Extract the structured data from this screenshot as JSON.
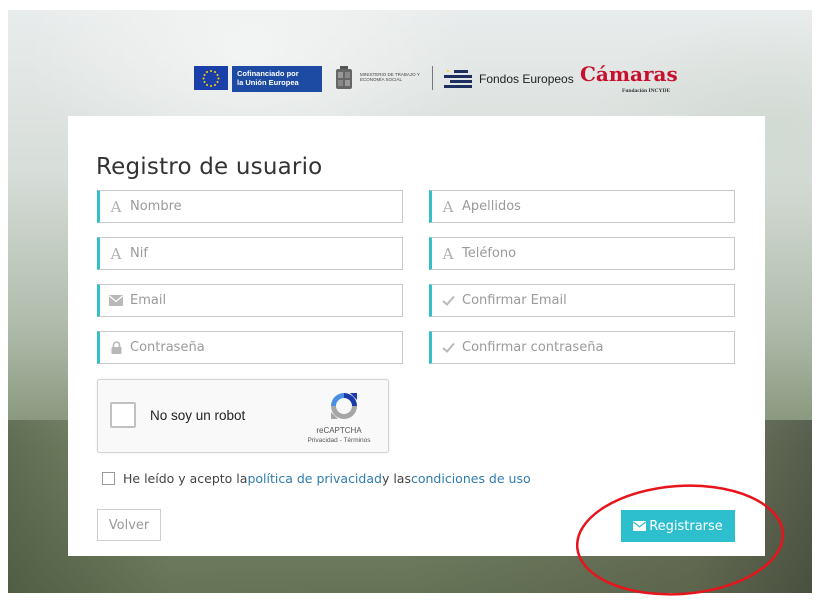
{
  "logos": {
    "eu_line1": "Cofinanciado por",
    "eu_line2": "la Unión Europea",
    "ministerio_text": "MINISTERIO DE TRABAJO Y ECONOMÍA SOCIAL",
    "fondos_text": "Fondos Europeos",
    "camaras_text": "Cámaras",
    "camaras_sub": "Fundación INCYDE"
  },
  "form": {
    "title": "Registro de usuario",
    "fields": {
      "nombre": {
        "placeholder": "Nombre",
        "value": "",
        "icon": "letter-a-icon"
      },
      "apellidos": {
        "placeholder": "Apellidos",
        "value": "",
        "icon": "letter-a-icon"
      },
      "nif": {
        "placeholder": "Nif",
        "value": "",
        "icon": "letter-a-icon"
      },
      "telefono": {
        "placeholder": "Teléfono",
        "value": "",
        "icon": "letter-a-icon"
      },
      "email": {
        "placeholder": "Email",
        "value": "",
        "icon": "envelope-icon"
      },
      "confirmar_email": {
        "placeholder": "Confirmar Email",
        "value": "",
        "icon": "check-icon"
      },
      "contrasena": {
        "placeholder": "Contraseña",
        "value": "",
        "icon": "lock-icon"
      },
      "confirmar_contrasena": {
        "placeholder": "Confirmar contraseña",
        "value": "",
        "icon": "check-icon"
      }
    },
    "letter_icon_glyph": "A",
    "captcha": {
      "label": "No soy un robot",
      "brand": "reCAPTCHA",
      "links": "Privacidad - Términos"
    },
    "terms": {
      "prefix": "He leído y acepto la ",
      "privacy_link": "política de privacidad",
      "middle": " y las ",
      "conditions_link": "condiciones de uso",
      "checked": false
    },
    "buttons": {
      "back_label": "Volver",
      "register_label": "Registrarse"
    }
  },
  "colors": {
    "accent": "#2ebfcf",
    "field_accent_border": "#35bfcb",
    "link": "#2f7cb0",
    "annotation_circle": "#e8141c",
    "camaras_red": "#c8102e",
    "eu_blue": "#1d4aa3"
  }
}
